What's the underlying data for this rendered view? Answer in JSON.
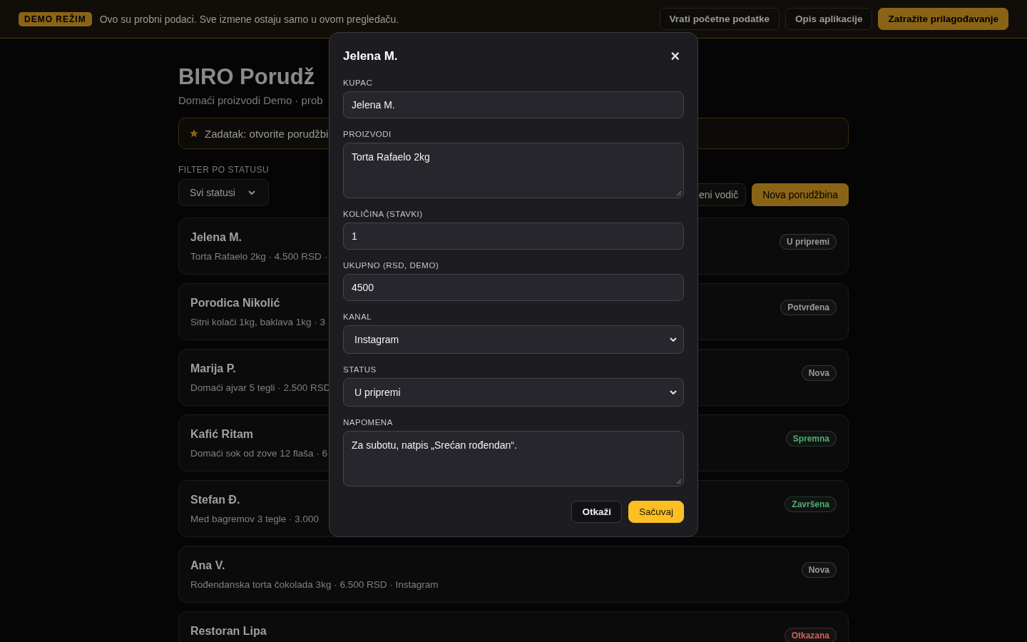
{
  "topbar": {
    "badge": "DEMO REŽIM",
    "notice": "Ovo su probni podaci. Sve izmene ostaju samo u ovom pregledaču.",
    "buttons": [
      {
        "label": "Vrati početne podatke",
        "kind": "ghost"
      },
      {
        "label": "Opis aplikacije",
        "kind": "ghost"
      },
      {
        "label": "Zatražite prilagođavanje",
        "kind": "primary"
      }
    ]
  },
  "header": {
    "title": "BIRO Porudž",
    "subtitle": "Domaći proizvodi Demo · prob"
  },
  "task": {
    "text": "Zadatak: otvorite porudžbi"
  },
  "filter": {
    "label": "FILTER PO STATUSU",
    "value": "Svi statusi"
  },
  "actions": [
    {
      "label": "eni vodič",
      "kind": "ghost"
    },
    {
      "label": "Nova porudžbina",
      "kind": "primary"
    }
  ],
  "orders": [
    {
      "name": "Jelena M.",
      "details": "Torta Rafaelo 2kg · 4.500 RSD ·",
      "status": "U pripremi",
      "color": "#9a9aa0"
    },
    {
      "name": "Porodica Nikolić",
      "details": "Sitni kolači 1kg, baklava 1kg · 3",
      "status": "Potvrđena",
      "color": "#9a9aa0"
    },
    {
      "name": "Marija P.",
      "details": "Domaći ajvar 5 tegli · 2.500 RSD",
      "status": "Nova",
      "color": "#9a9aa0"
    },
    {
      "name": "Kafić Ritam",
      "details": "Domaći sok od zove 12 flaša · 6",
      "status": "Spremna",
      "color": "#4caf6e"
    },
    {
      "name": "Stefan Đ.",
      "details": "Med bagremov 3 tegle · 3.000",
      "status": "Završena",
      "color": "#4caf6e"
    },
    {
      "name": "Ana V.",
      "details": "Rođendanska torta čokolada 3kg · 6.500 RSD · Instagram",
      "status": "Nova",
      "color": "#9a9aa0"
    },
    {
      "name": "Restoran Lipa",
      "status": "Otkazana",
      "color": "#d0625a"
    }
  ],
  "modal": {
    "title": "Jelena M.",
    "close": "×",
    "fields": [
      {
        "label": "KUPAC",
        "kind": "text",
        "value": "Jelena M."
      },
      {
        "label": "PROIZVODI",
        "kind": "textarea",
        "value": "Torta Rafaelo 2kg"
      },
      {
        "label": "KOLIČINA (STAVKI)",
        "kind": "text",
        "value": "1"
      },
      {
        "label": "UKUPNO (RSD, DEMO)",
        "kind": "text",
        "value": "4500"
      },
      {
        "label": "KANAL",
        "kind": "select",
        "value": "Instagram"
      },
      {
        "label": "STATUS",
        "kind": "select",
        "value": "U pripremi"
      },
      {
        "label": "NAPOMENA",
        "kind": "textarea",
        "value": "Za subotu, natpis „Srećan rođendan“."
      }
    ],
    "buttons": [
      {
        "label": "Otkaži",
        "kind": "ghost"
      },
      {
        "label": "Sačuvaj",
        "kind": "primary"
      }
    ]
  }
}
